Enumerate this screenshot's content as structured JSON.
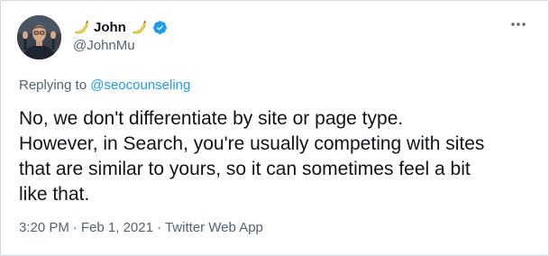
{
  "author": {
    "name": "John",
    "handle": "@JohnMu",
    "verified": true,
    "name_emoji": "banana"
  },
  "icons": {
    "more": "more-horizontal-icon",
    "verified": "verified-badge-icon",
    "banana": "banana-icon"
  },
  "colors": {
    "link": "#1d9bf0",
    "muted": "#536471",
    "text": "#0f1419",
    "verified": "#1d9bf0"
  },
  "reply": {
    "prefix": "Replying to ",
    "to": "@seocounseling"
  },
  "tweet": {
    "text": "No, we don't differentiate by site or page type.\nHowever, in Search, you're usually competing with sites\nthat are similar to yours, so it can sometimes feel a bit\nlike that."
  },
  "meta": {
    "time": "3:20 PM",
    "date": "Feb 1, 2021",
    "source": "Twitter Web App",
    "separator": "·"
  }
}
